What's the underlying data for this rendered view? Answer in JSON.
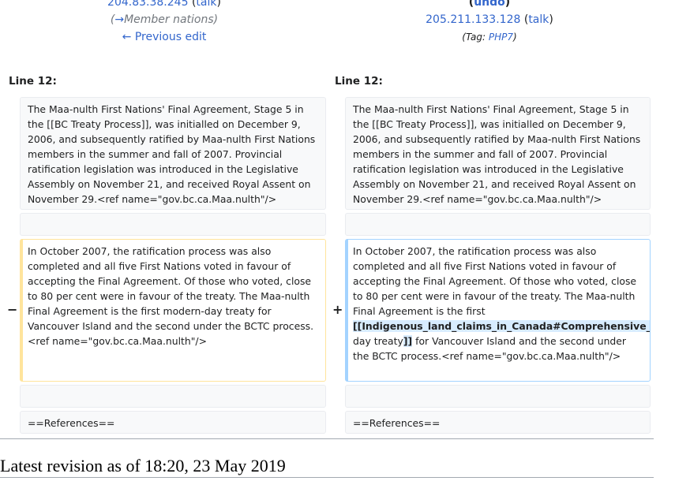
{
  "left_header": {
    "ip": "204.83.38.245",
    "talk": "talk",
    "summary": "Member nations",
    "summary_arrow": "→",
    "prev_edit": "← Previous edit"
  },
  "right_header": {
    "undo": "undo",
    "ip": "205.211.133.128",
    "talk": "talk",
    "tag_prefix": "Tag: ",
    "tag": "PHP7"
  },
  "left_line_label": "Line 12:",
  "right_line_label": "Line 12:",
  "context_paragraph": "The Maa-nulth First Nations' Final Agreement, Stage 5 in the [[BC Treaty Process]], was initialled on December 9, 2006, and subsequently ratified by Maa-nulth First Nations members in the summer and fall of 2007. Provincial ratification legislation was introduced in the Legislative Assembly on November 21, and received Royal Assent on November 29.<ref name=\"gov.bc.ca.Maa.nulth\"/>",
  "deleted_line": {
    "marker": "−",
    "text": "In October 2007, the ratification process was also completed and all five First Nations voted in favour of accepting the Final Agreement. Of those who voted, close to 80 per cent were in favour of the treaty.  The Maa-nulth Final Agreement is the first modern-day treaty for Vancouver Island and the second under the BCTC process.<ref name=\"gov.bc.ca.Maa.nulth\"/>"
  },
  "added_line": {
    "marker": "+",
    "before": "In October 2007, the ratification process was also completed and all five First Nations voted in favour of accepting the Final Agreement. Of those who voted, close to 80 per cent were in favour of the treaty.  The Maa-nulth Final Agreement is the first ",
    "ins_open": "[[Indigenous_land_claims_in_Canada#Comprehensive_claims",
    "pipe": "|",
    "middle": "modern-day treaty",
    "ins_close": "]]",
    "after": " for Vancouver Island and the second under the BCTC process.<ref name=\"gov.bc.ca.Maa.nulth\"/>"
  },
  "references_left": "==References==",
  "references_right": "==References==",
  "latest_revision": "Latest revision as of 18:20, 23 May 2019"
}
